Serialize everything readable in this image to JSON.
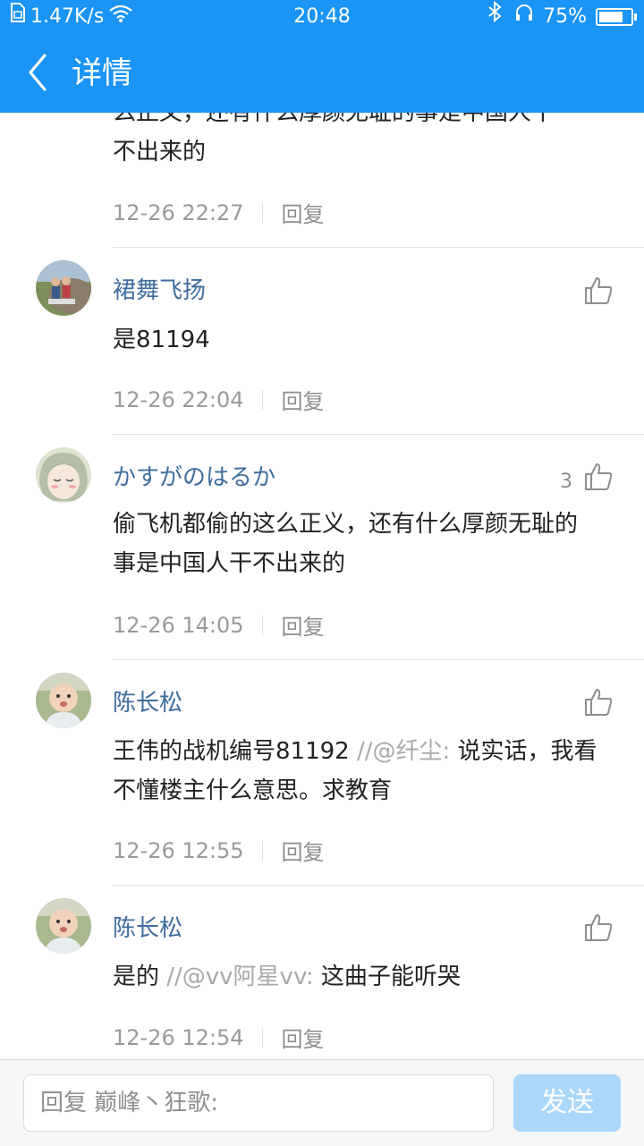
{
  "status_bar": {
    "net_speed": "1.47K/s",
    "time": "20:48",
    "battery": "75%",
    "battery_level": 0.75
  },
  "header": {
    "title": "详情",
    "back_icon": "chevron-left-icon"
  },
  "partial_comment": {
    "content_top": "么正义，还有什么厚颜无耻的事是中国人干",
    "content_bottom": "不出来的",
    "time": "12-26 22:27",
    "reply_label": "回复"
  },
  "comments": [
    {
      "username": "裙舞飞扬",
      "likes": "",
      "content": "是81194",
      "quote": "",
      "quote_text": "",
      "time": "12-26 22:04",
      "reply_label": "回复"
    },
    {
      "username": "かすがのはるか",
      "likes": "3",
      "content": "偷飞机都偷的这么正义，还有什么厚颜无耻的事是中国人干不出来的",
      "quote": "",
      "quote_text": "",
      "time": "12-26 14:05",
      "reply_label": "回复"
    },
    {
      "username": "陈长松",
      "likes": "",
      "content": "王伟的战机编号81192 ",
      "quote": "//@纤尘:",
      "quote_text": " 说实话，我看不懂楼主什么意思。求教育",
      "time": "12-26 12:55",
      "reply_label": "回复"
    },
    {
      "username": "陈长松",
      "likes": "",
      "content": "是的 ",
      "quote": "//@vv阿星vv:",
      "quote_text": " 这曲子能听哭",
      "time": "12-26 12:54",
      "reply_label": "回复"
    }
  ],
  "bottom_bar": {
    "reply_placeholder": "回复 巅峰丶狂歌:",
    "send_label": "发送"
  },
  "colors": {
    "header_bg": "#1a94f5",
    "username": "#3f6d9f",
    "send_button": "#abd7fb"
  }
}
